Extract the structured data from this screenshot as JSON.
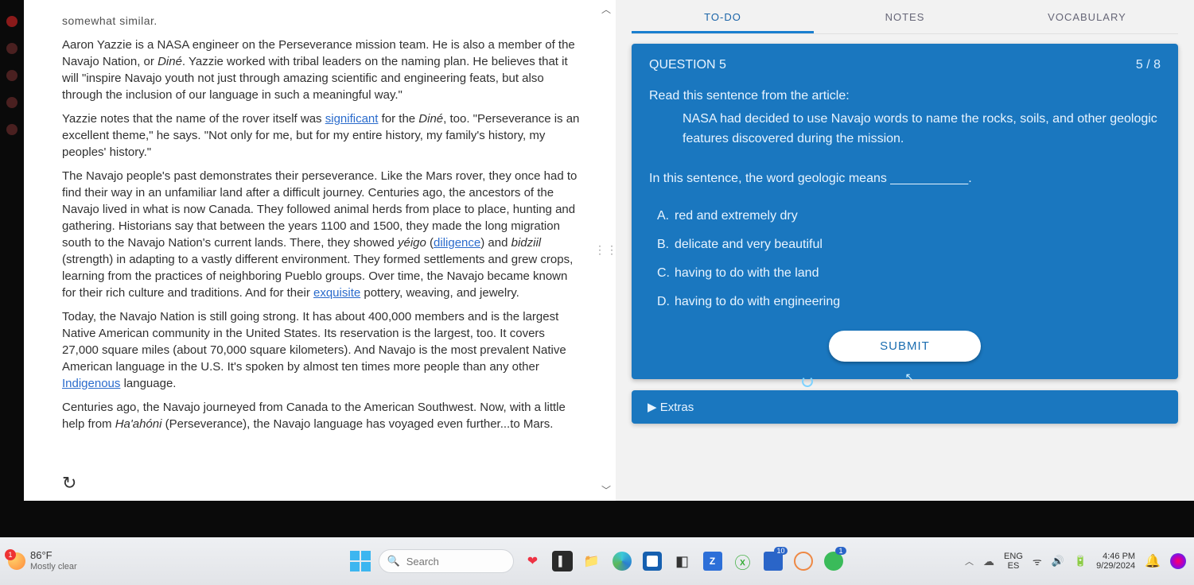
{
  "article": {
    "cutoff_top": "somewhat similar.",
    "p1_a": "Aaron Yazzie is a NASA engineer on the Perseverance mission team. He is also a member of the Navajo Nation, or ",
    "p1_ital1": "Diné",
    "p1_b": ". Yazzie worked with tribal leaders on the naming plan. He believes that it will \"inspire Navajo youth not just through amazing scientific and engineering feats, but also through the inclusion of our language in such a meaningful way.\"",
    "p2_a": "Yazzie notes that the name of the rover itself was ",
    "p2_link": "significant",
    "p2_b": " for the ",
    "p2_ital": "Diné",
    "p2_c": ", too. \"Perseverance is an excellent theme,\" he says. \"Not only for me, but for my entire history, my family's history, my peoples' history.\"",
    "p3_a": "The Navajo people's past demonstrates their perseverance. Like the Mars rover, they once had to find their way in an unfamiliar land after a difficult journey. Centuries ago, the ancestors of the Navajo lived in what is now Canada. They followed animal herds from place to place, hunting and gathering. Historians say that between the years 1100 and 1500, they made the long migration south to the Navajo Nation's current lands. There, they showed ",
    "p3_ital1": "yéigo",
    "p3_b": " (",
    "p3_link1": "diligence",
    "p3_c": ") and ",
    "p3_ital2": "bidziil",
    "p3_d": " (strength) in adapting to a vastly different environment. They formed settlements and grew crops, learning from the practices of neighboring Pueblo groups. Over time, the Navajo became known for their rich culture and traditions. And for their ",
    "p3_link2": "exquisite",
    "p3_e": " pottery, weaving, and jewelry.",
    "p4_a": "Today, the Navajo Nation is still going strong. It has about 400,000 members and is the largest Native American community in the United States. Its reservation is the largest, too. It covers 27,000 square miles (about 70,000 square kilometers). And Navajo is the most prevalent Native American language in the U.S. It's spoken by almost ten times more people than any other ",
    "p4_link": "Indigenous",
    "p4_b": " language.",
    "p5_a": "Centuries ago, the Navajo journeyed from Canada to the American Southwest. Now, with a little help from ",
    "p5_ital": "Ha'ahóni",
    "p5_b": " (Perseverance), the Navajo language has voyaged even further...to Mars."
  },
  "tabs": {
    "todo": "TO-DO",
    "notes": "NOTES",
    "vocab": "VOCABULARY"
  },
  "question": {
    "title": "QUESTION 5",
    "counter": "5 / 8",
    "lead": "Read this sentence from the article:",
    "quote_a": "NASA had decided to use Navajo words to name the rocks, soils, and other ",
    "quote_ital": "geologic",
    "quote_b": " features discovered during the mission.",
    "prompt_a": "In this sentence, the word ",
    "prompt_ital": "geologic",
    "prompt_b": " means ___________.",
    "options": [
      {
        "letter": "A.",
        "text": "red and extremely dry"
      },
      {
        "letter": "B.",
        "text": "delicate and very beautiful"
      },
      {
        "letter": "C.",
        "text": "having to do with the land"
      },
      {
        "letter": "D.",
        "text": "having to do with engineering"
      }
    ],
    "submit": "SUBMIT"
  },
  "extras": {
    "label": "Extras"
  },
  "taskbar": {
    "weather_badge": "1",
    "weather_temp": "86°F",
    "weather_status": "Mostly clear",
    "search_placeholder": "Search",
    "lang_top": "ENG",
    "lang_bot": "ES",
    "time": "4:46 PM",
    "date": "9/29/2024",
    "app_badge_word": "10",
    "app_badge_green": "1"
  }
}
